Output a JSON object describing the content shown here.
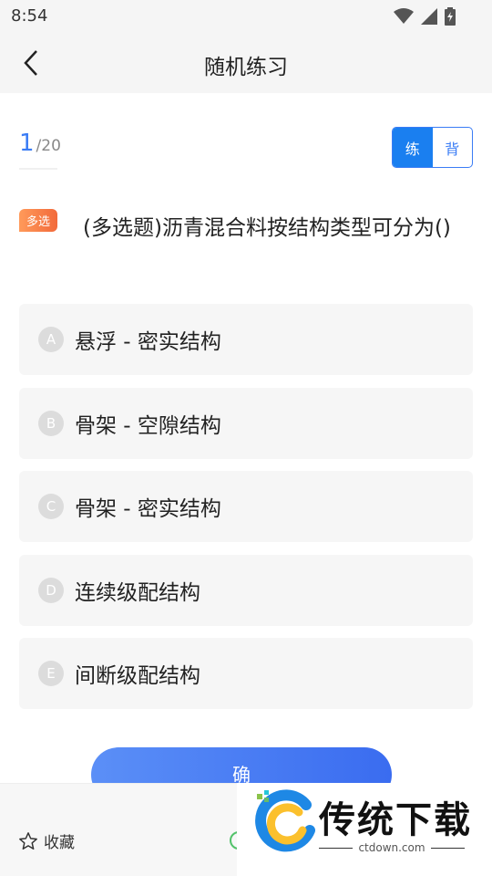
{
  "status_bar": {
    "time": "8:54"
  },
  "nav": {
    "title": "随机练习"
  },
  "progress": {
    "current": "1",
    "total": "/20"
  },
  "mode_toggle": {
    "practice_label": "练",
    "memorize_label": "背"
  },
  "question": {
    "type_badge": "多选",
    "text": "(多选题)沥青混合料按结构类型可分为()"
  },
  "options": [
    {
      "letter": "A",
      "text": "悬浮 - 密实结构"
    },
    {
      "letter": "B",
      "text": "骨架 - 空隙结构"
    },
    {
      "letter": "C",
      "text": "骨架 - 密实结构"
    },
    {
      "letter": "D",
      "text": "连续级配结构"
    },
    {
      "letter": "E",
      "text": "间断级配结构"
    }
  ],
  "confirm": {
    "label": "确"
  },
  "bottom_bar": {
    "favorite_label": "收藏"
  },
  "watermark": {
    "title": "传统下载",
    "url": "ctdown.com"
  },
  "colors": {
    "accent": "#3a7cf5",
    "badge": "#f26a3b",
    "option_bg": "#f6f6f6"
  }
}
